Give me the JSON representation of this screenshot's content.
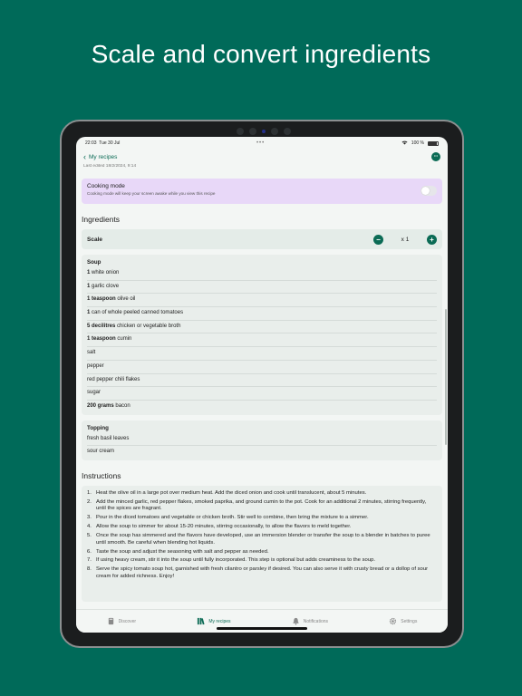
{
  "headline": "Scale and convert ingredients",
  "status": {
    "time": "22:03",
    "date": "Tue 30 Jul",
    "battery": "100 %"
  },
  "nav": {
    "back_label": "My recipes",
    "more": "•••"
  },
  "last_edited": "Last edited 18/2/2024, 9:14",
  "cooking_mode": {
    "title": "Cooking mode",
    "description": "Cooking mode will keep your screen awake while you view this recipe",
    "enabled": false
  },
  "ingredients": {
    "title": "Ingredients",
    "scale": {
      "label": "Scale",
      "value": "x 1",
      "minus": "−",
      "plus": "+"
    },
    "groups": [
      {
        "title": "Soup",
        "items": [
          {
            "qty": "1",
            "text": "white onion"
          },
          {
            "qty": "1",
            "text": "garlic clove"
          },
          {
            "qty": "1 teaspoon",
            "text": "olive oil"
          },
          {
            "qty": "1",
            "text": "can of whole peeled canned tomatoes"
          },
          {
            "qty": "5 decilitres",
            "text": "chicken or vegetable broth"
          },
          {
            "qty": "1 teaspoon",
            "text": "cumin"
          },
          {
            "qty": "",
            "text": "salt"
          },
          {
            "qty": "",
            "text": "pepper"
          },
          {
            "qty": "",
            "text": "red pepper chili flakes"
          },
          {
            "qty": "",
            "text": "sugar"
          },
          {
            "qty": "200 grams",
            "text": "bacon"
          }
        ]
      },
      {
        "title": "Topping",
        "items": [
          {
            "qty": "",
            "text": "fresh basil leaves"
          },
          {
            "qty": "",
            "text": "sour cream"
          }
        ]
      }
    ]
  },
  "instructions": {
    "title": "Instructions",
    "steps": [
      "Heat the olive oil in a large pot over medium heat. Add the diced onion and cook until translucent, about 5 minutes.",
      "Add the minced garlic, red pepper flakes, smoked paprika, and ground cumin to the pot. Cook for an additional 2 minutes, stirring frequently, until the spices are fragrant.",
      "Pour in the diced tomatoes and vegetable or chicken broth. Stir well to combine, then bring the mixture to a simmer.",
      "Allow the soup to simmer for about 15-20 minutes, stirring occasionally, to allow the flavors to meld together.",
      "Once the soup has simmered and the flavors have developed, use an immersion blender or transfer the soup to a blender in batches to puree until smooth. Be careful when blending hot liquids.",
      "Taste the soup and adjust the seasoning with salt and pepper as needed.",
      "If using heavy cream, stir it into the soup until fully incorporated. This step is optional but adds creaminess to the soup.",
      "Serve the spicy tomato soup hot, garnished with fresh cilantro or parsley if desired. You can also serve it with crusty bread or a dollop of sour cream for added richness. Enjoy!"
    ]
  },
  "tabs": [
    {
      "id": "discover",
      "label": "Discover",
      "icon": "phone-book-icon",
      "active": false
    },
    {
      "id": "my-recipes",
      "label": "My recipes",
      "icon": "books-icon",
      "active": true
    },
    {
      "id": "notifications",
      "label": "Notifications",
      "icon": "bell-icon",
      "active": false
    },
    {
      "id": "settings",
      "label": "Settings",
      "icon": "gear-icon",
      "active": false
    }
  ],
  "colors": {
    "background": "#006a59",
    "accent": "#0b6b55",
    "cooking_bg": "#e8d8f8"
  }
}
